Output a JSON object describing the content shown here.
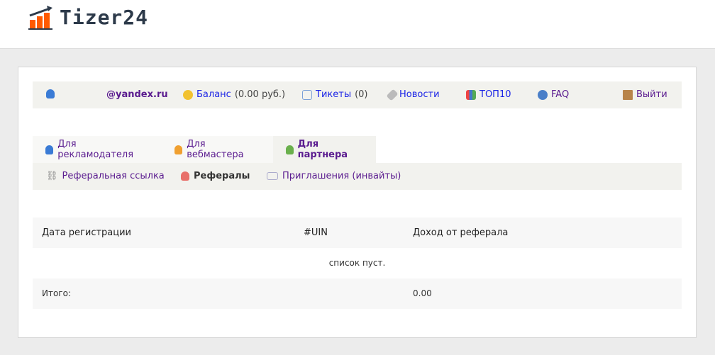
{
  "logo": {
    "text": "Tizer24"
  },
  "topnav": {
    "email": "@yandex.ru",
    "balance_label": "Баланс",
    "balance_value": "(0.00 руб.)",
    "tickets_label": "Тикеты",
    "tickets_count": "(0)",
    "news": "Новости",
    "top10": "ТОП10",
    "faq": "FAQ",
    "logout": "Выйти"
  },
  "tabs": [
    {
      "label": "Для рекламодателя"
    },
    {
      "label": "Для вебмастера"
    },
    {
      "label": "Для партнера",
      "active": true
    }
  ],
  "subnav": [
    {
      "label": "Реферальная ссылка"
    },
    {
      "label": "Рефералы",
      "active": true
    },
    {
      "label": "Приглашения (инвайты)"
    }
  ],
  "table": {
    "headers": [
      "Дата регистрации",
      "#UIN",
      "Доход от реферала"
    ],
    "empty": "список пуст.",
    "total_label": "Итого:",
    "total_value": "0.00"
  }
}
